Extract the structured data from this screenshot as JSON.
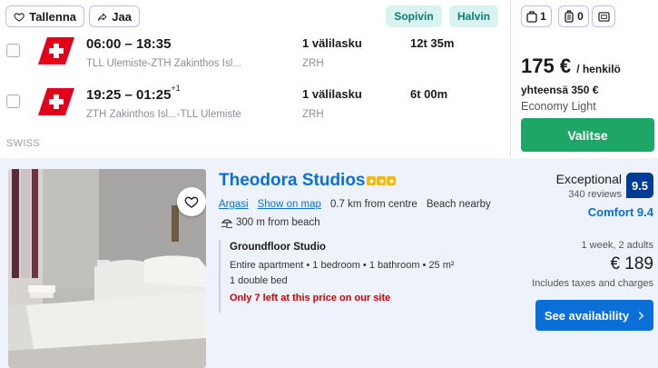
{
  "flight": {
    "save_label": "Tallenna",
    "share_label": "Jaa",
    "tags": {
      "fit": "Sopivin",
      "cheapest": "Halvin"
    },
    "legs": [
      {
        "time": "06:00 – 18:35",
        "day_offset": "",
        "route": "TLL Ulemiste-ZTH Zakinthos Isl...",
        "stops": "1 välilasku",
        "via": "ZRH",
        "duration": "12t 35m"
      },
      {
        "time": "19:25 – 01:25",
        "day_offset": "+1",
        "route": "ZTH Zakinthos Isl...-TLL Ulemiste",
        "stops": "1 välilasku",
        "via": "ZRH",
        "duration": "6t 00m"
      }
    ],
    "airline": "SWISS",
    "bags": {
      "personal": "1",
      "carry_on": "0"
    },
    "price": "175 €",
    "price_unit": "/ henkilö",
    "total": "yhteensä 350 €",
    "fare_class": "Economy Light",
    "select_label": "Valitse",
    "colors": {
      "accent": "#1fa566",
      "airline_red": "#e3001b"
    }
  },
  "hotel": {
    "name": "Theodora Studios",
    "stars": 3,
    "location_link": "Argasi",
    "map_link": "Show on map",
    "distance": "0.7 km from centre",
    "beach_nearby": "Beach nearby",
    "beach_distance": "300 m from beach",
    "room_title": "Groundfloor Studio",
    "room_spec": "Entire apartment • 1 bedroom • 1 bathroom • 25 m²",
    "room_bed": "1 double bed",
    "availability_note": "Only 7 left at this price on our site",
    "review_word": "Exceptional",
    "review_count": "340 reviews",
    "score": "9.5",
    "comfort": "Comfort 9.4",
    "stay_info": "1 week, 2 adults",
    "price": "€ 189",
    "taxes": "Includes taxes and charges",
    "cta_label": "See availability",
    "colors": {
      "link": "#0a6fd6",
      "score_bg": "#003b95",
      "warning": "#cc0000"
    }
  }
}
